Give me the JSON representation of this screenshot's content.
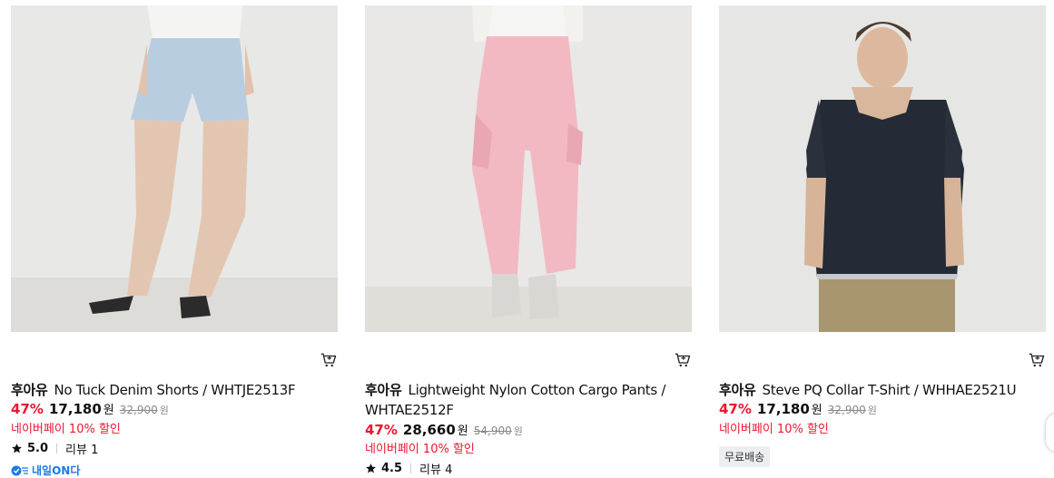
{
  "products": [
    {
      "brand": "후아유",
      "name": "No Tuck Denim Shorts / WHTJE2513F",
      "discount": "47%",
      "price": "17,180",
      "price_unit": "원",
      "original_price": "32,900",
      "original_unit": "원",
      "promo": "네이버페이 10% 할인",
      "rating": "5.0",
      "reviews": "리뷰 1",
      "delivery_tag": "내일ON다"
    },
    {
      "brand": "후아유",
      "name": "Lightweight Nylon Cotton Cargo Pants / WHTAE2512F",
      "discount": "47%",
      "price": "28,660",
      "price_unit": "원",
      "original_price": "54,900",
      "original_unit": "원",
      "promo": "네이버페이 10% 할인",
      "rating": "4.5",
      "reviews": "리뷰 4"
    },
    {
      "brand": "후아유",
      "name": "Steve PQ Collar T-Shirt / WHHAE2521U",
      "discount": "47%",
      "price": "17,180",
      "price_unit": "원",
      "original_price": "32,900",
      "original_unit": "원",
      "promo": "네이버페이 10% 할인",
      "badge": "무료배송"
    }
  ],
  "colors": {
    "discount": "#f0142f",
    "delivery": "#1a7ae9",
    "badge_bg": "#eceef1"
  },
  "icons": {
    "cart": "cart-icon",
    "star": "star-icon"
  }
}
